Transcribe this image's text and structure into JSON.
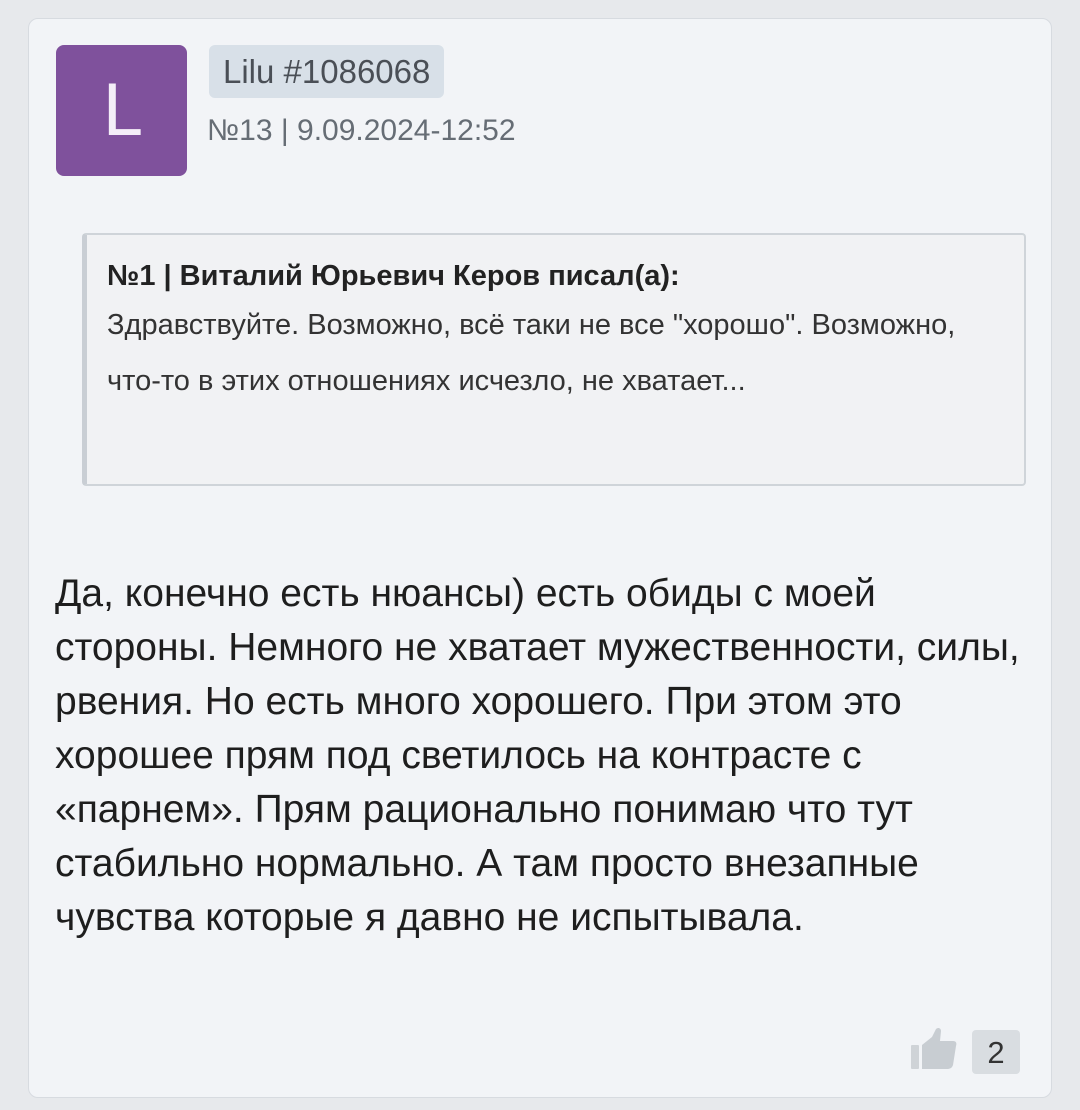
{
  "post": {
    "avatar_letter": "L",
    "avatar_color": "#7f519c",
    "username": "Lilu #1086068",
    "meta": "№13 | 9.09.2024-12:52",
    "quote": {
      "header": "№1 | Виталий Юрьевич Керов писал(а):",
      "text": "Здравствуйте. Возможно, всё таки не все \"хорошо\". Возможно, что-то в этих отношениях исчезло, не хватает..."
    },
    "body": "Да, конечно есть нюансы) есть обиды с моей стороны. Немного не хватает мужественности, силы, рвения. Но есть много хорошего. При этом это хорошее прям под светилось на контрасте с «парнем». Прям рационально понимаю что тут стабильно нормально. А там просто внезапные чувства которые я давно не испытывала.",
    "like_icon": "thumbs-up-icon",
    "likes": "2"
  }
}
